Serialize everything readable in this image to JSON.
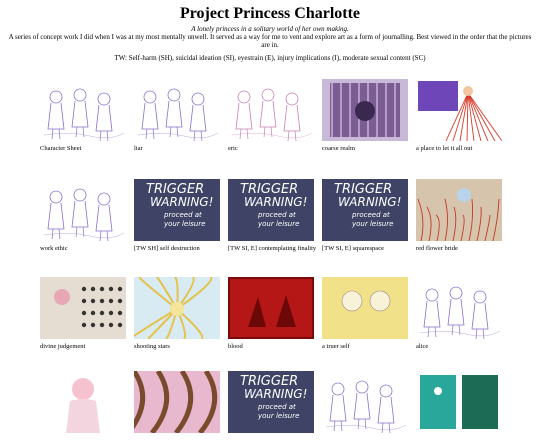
{
  "page": {
    "title": "Project Princess Charlotte",
    "subtitle": "A lonely princess in a solitary world of her own making.",
    "description": "A series of concept work I did when I was at my most mentally unwell. It served as a way for me to vent and explore art as a form of journalling. Best viewed in the order that the pictures are in.",
    "trigger_warnings": "TW: Self-harm (SH), suicidal ideation (SI), eyestrain (E), injury implications (I), moderate sexual content (SC)"
  },
  "gallery": [
    [
      {
        "caption": "Character Sheet",
        "art": "sketch-purple"
      },
      {
        "caption": "liar",
        "art": "sketch-purple"
      },
      {
        "caption": "eric",
        "art": "sketch-pink"
      },
      {
        "caption": "coarse realm",
        "art": "coarse"
      },
      {
        "caption": "a place to let it all out",
        "art": "letout"
      }
    ],
    [
      {
        "caption": "work ethic",
        "art": "sketch-purple"
      },
      {
        "caption": "[TW SH] self destruction",
        "art": "trigger"
      },
      {
        "caption": "[TW SI, E] contemplating finality",
        "art": "trigger"
      },
      {
        "caption": "[TW SI, E] squarespace",
        "art": "trigger"
      },
      {
        "caption": "red flower bride",
        "art": "redflower"
      }
    ],
    [
      {
        "caption": "divine judgement",
        "art": "divine"
      },
      {
        "caption": "shooting stars",
        "art": "stars"
      },
      {
        "caption": "blood",
        "art": "blood"
      },
      {
        "caption": "a truer self",
        "art": "yellow"
      },
      {
        "caption": "alice",
        "art": "sketch-purple"
      }
    ],
    [
      {
        "caption": "",
        "art": "pinkgirl"
      },
      {
        "caption": "",
        "art": "brown"
      },
      {
        "caption": "",
        "art": "trigger"
      },
      {
        "caption": "",
        "art": "sketch-purple"
      },
      {
        "caption": "",
        "art": "teal"
      }
    ]
  ],
  "trigger_card": {
    "line1": "TRIGGER",
    "line2": "WARNING!",
    "line3": "proceed at",
    "line4": "your leisure"
  }
}
